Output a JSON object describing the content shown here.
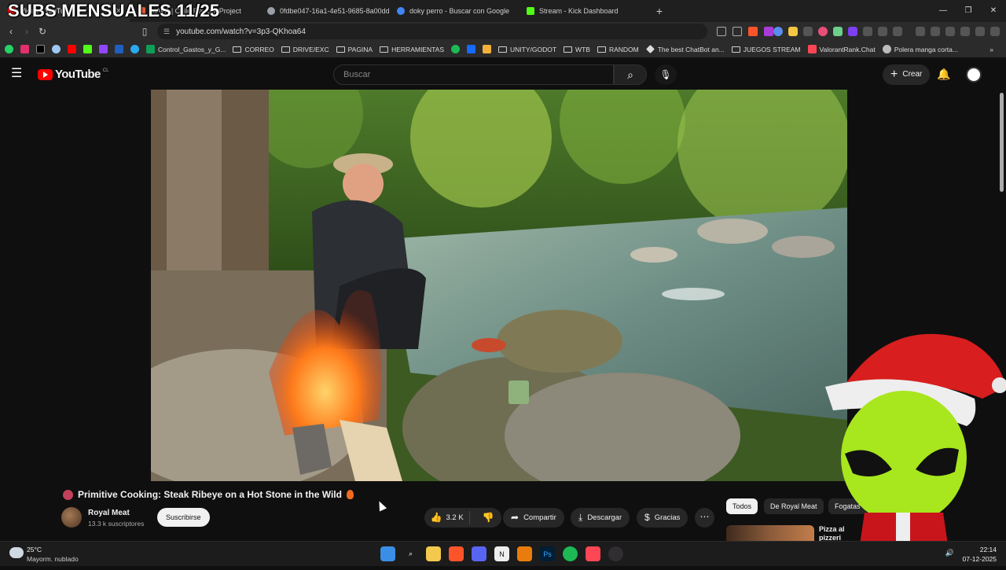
{
  "overlay": {
    "title": "SUBS MENSUALES 11/25"
  },
  "tabs": [
    {
      "label": "Video - YouTube",
      "active": true,
      "color": "#ff0000"
    },
    {
      "label": "MAPA | Chile Rework Project",
      "active": false,
      "color": "#e05a3a"
    },
    {
      "label": "0fdbe047-16a1-4e51-9685-8a00dde",
      "active": false,
      "color": "#9aa0a6"
    },
    {
      "label": "doky perro - Buscar con Google",
      "active": false,
      "color": "#4285f4"
    },
    {
      "label": "Stream - Kick Dashboard",
      "active": false,
      "color": "#53fc18"
    }
  ],
  "address": {
    "url": "youtube.com/watch?v=3p3-QKhoa64"
  },
  "bookmarks": [
    {
      "label": "Control_Gastos_y_G...",
      "type": "sheet",
      "color": "#0f9d58"
    },
    {
      "label": "CORREO",
      "type": "folder"
    },
    {
      "label": "DRIVE/EXC",
      "type": "folder"
    },
    {
      "label": "PAGINA",
      "type": "folder"
    },
    {
      "label": "HERRAMIENTAS",
      "type": "folder"
    },
    {
      "label": "UNITY/GODOT",
      "type": "folder"
    },
    {
      "label": "WTB",
      "type": "folder"
    },
    {
      "label": "RANDOM",
      "type": "folder"
    },
    {
      "label": "The best ChatBot an...",
      "type": "site",
      "color": "#dddddd"
    },
    {
      "label": "JUEGOS STREAM",
      "type": "folder"
    },
    {
      "label": "ValorantRank.Chat",
      "type": "site",
      "color": "#ff4655"
    },
    {
      "label": "Polera manga corta...",
      "type": "site",
      "color": "#bbbbbb"
    }
  ],
  "youtube": {
    "logo_text": "YouTube",
    "country": "CL",
    "search_placeholder": "Buscar",
    "create_label": "Crear"
  },
  "video": {
    "title": "Primitive Cooking: Steak Ribeye on a Hot Stone in the Wild",
    "channel": "Royal Meat",
    "subscribers": "13.3 k suscriptores",
    "subscribe_label": "Suscribirse",
    "likes": "3.2 K",
    "share_label": "Compartir",
    "download_label": "Descargar",
    "thanks_label": "Gracias"
  },
  "chips": [
    {
      "label": "Todos",
      "active": true
    },
    {
      "label": "De Royal Meat",
      "active": false
    },
    {
      "label": "Fogatas",
      "active": false
    }
  ],
  "recommendation": {
    "title": "Pizza al pizzeri"
  },
  "taskbar": {
    "weather_temp": "25°C",
    "weather_desc": "Mayorm. nublado",
    "time": "22:14",
    "date": "07-12-2025"
  }
}
